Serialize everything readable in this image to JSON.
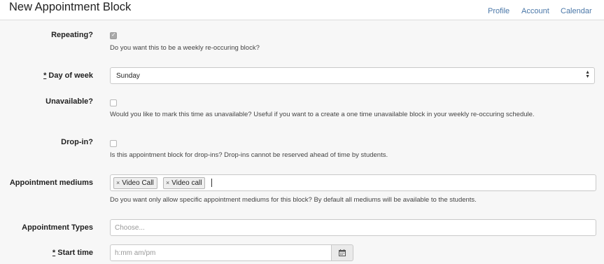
{
  "header": {
    "title": "New Appointment Block",
    "nav": {
      "profile": "Profile",
      "account": "Account",
      "calendar": "Calendar"
    }
  },
  "form": {
    "repeating": {
      "label": "Repeating?",
      "checked": true,
      "help": "Do you want this to be a weekly re-occuring block?"
    },
    "day_of_week": {
      "required_mark": "*",
      "label": "Day of week",
      "value": "Sunday"
    },
    "unavailable": {
      "label": "Unavailable?",
      "checked": false,
      "help": "Would you like to mark this time as unavailable? Useful if you want to a create a one time unavailable block in your weekly re-occuring schedule."
    },
    "drop_in": {
      "label": "Drop-in?",
      "checked": false,
      "help": "Is this appointment block for drop-ins? Drop-ins cannot be reserved ahead of time by students."
    },
    "appointment_mediums": {
      "label": "Appointment mediums",
      "tags": [
        "Video Call",
        "Video call"
      ],
      "remove_glyph": "×",
      "help": "Do you want only allow specific appointment mediums for this block? By default all mediums will be available to the students."
    },
    "appointment_types": {
      "label": "Appointment Types",
      "placeholder": "Choose..."
    },
    "start_time": {
      "required_mark": "*",
      "label": "Start time",
      "placeholder": "h:mm am/pm"
    }
  },
  "colors": {
    "link": "#4a77a8",
    "panel_bg": "#f7f7f7",
    "border": "#c9c9c9"
  },
  "icons": {
    "checkbox_checked": "check-icon",
    "select_arrows": "up-down-arrows-icon",
    "tag_remove": "close-icon",
    "calendar": "calendar-icon"
  }
}
